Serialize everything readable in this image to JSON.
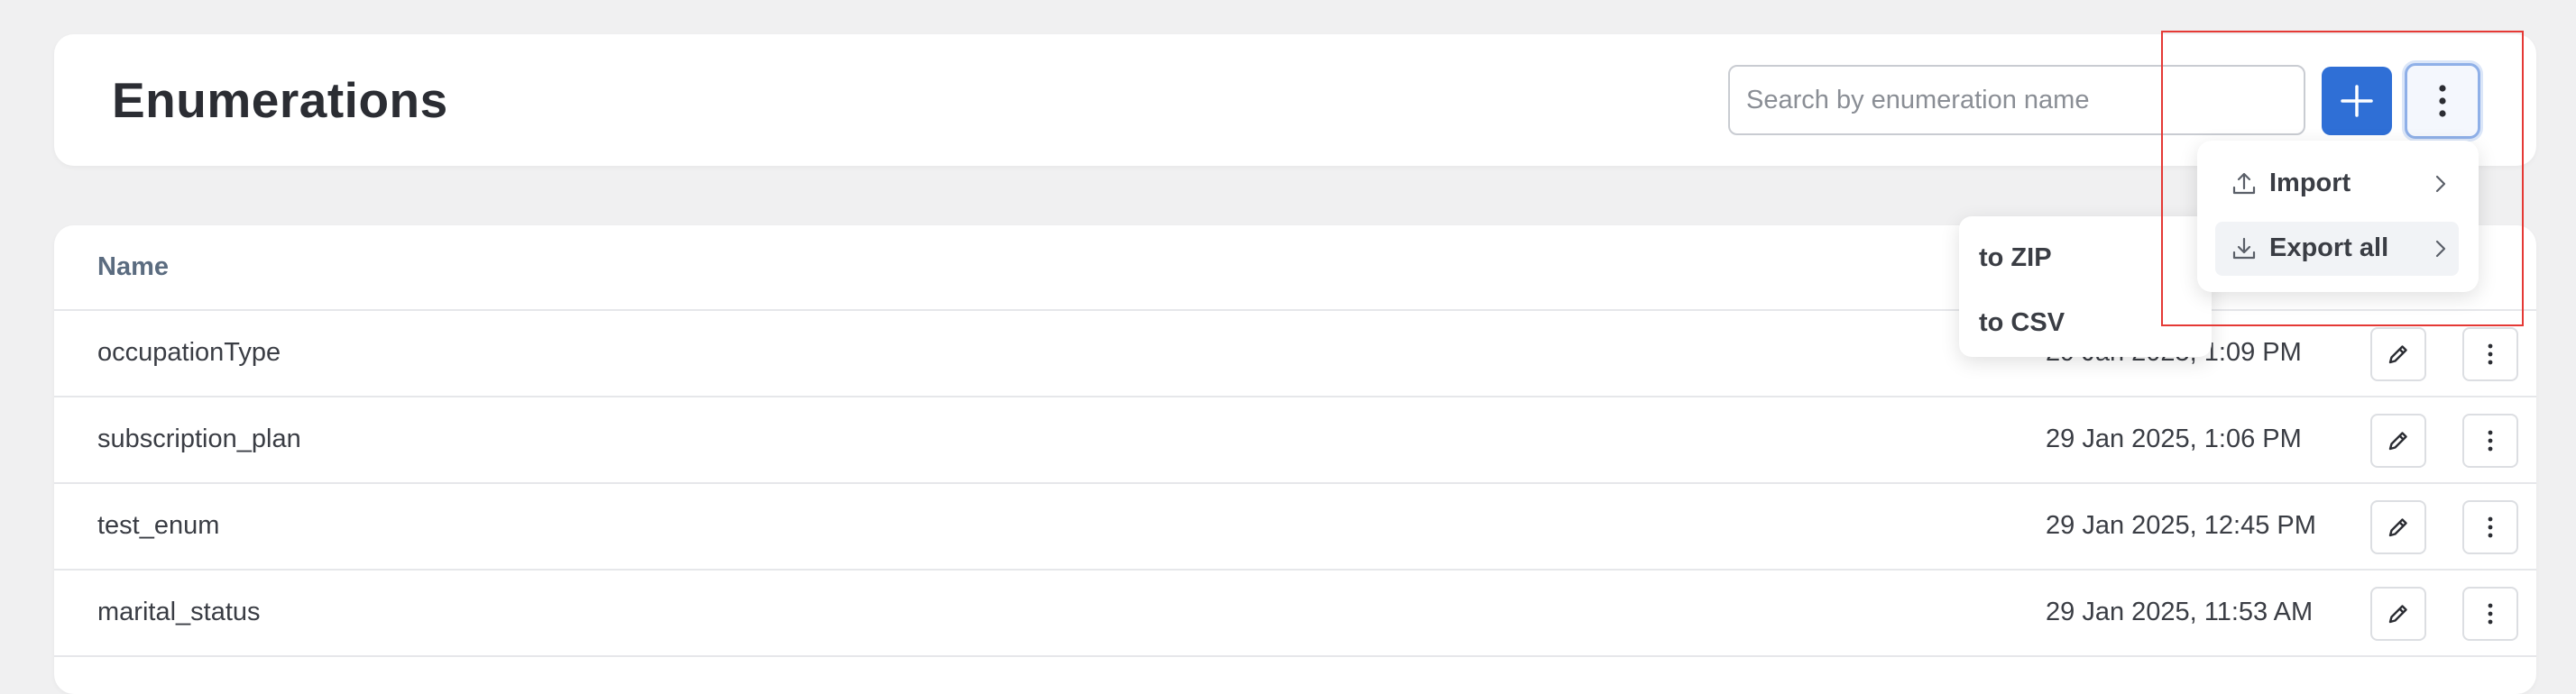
{
  "header": {
    "title": "Enumerations",
    "search_placeholder": "Search by enumeration name"
  },
  "table": {
    "columns": {
      "name": "Name"
    },
    "rows": [
      {
        "name": "occupationType",
        "date": "29 Jan 2025, 1:09 PM"
      },
      {
        "name": "subscription_plan",
        "date": "29 Jan 2025, 1:06 PM"
      },
      {
        "name": "test_enum",
        "date": "29 Jan 2025, 12:45 PM"
      },
      {
        "name": "marital_status",
        "date": "29 Jan 2025, 11:53 AM"
      }
    ]
  },
  "menu": {
    "import_label": "Import",
    "export_label": "Export all"
  },
  "submenu": {
    "zip_label": "to ZIP",
    "csv_label": "to CSV"
  },
  "icons": {
    "add": "plus-icon",
    "more": "kebab-icon",
    "import": "upload-icon",
    "export": "download-icon",
    "chevron": "chevron-right-icon",
    "edit": "pencil-icon"
  },
  "colors": {
    "primary": "#2f6fd6",
    "highlight": "#e53935"
  }
}
